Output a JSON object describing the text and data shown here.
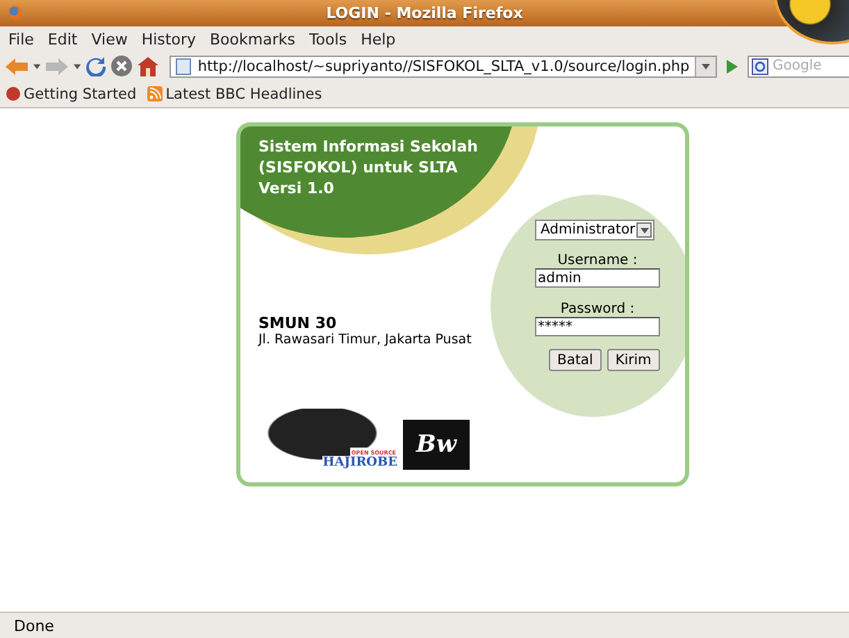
{
  "window": {
    "title": "LOGIN - Mozilla Firefox"
  },
  "menu": [
    "File",
    "Edit",
    "View",
    "History",
    "Bookmarks",
    "Tools",
    "Help"
  ],
  "address": {
    "value": "http://localhost/~supriyanto//SISFOKOL_SLTA_v1.0/source/login.php"
  },
  "search": {
    "placeholder": "Google"
  },
  "bookmarks": [
    "Getting Started",
    "Latest BBC Headlines"
  ],
  "login": {
    "title_lines": [
      "Sistem Informasi Sekolah",
      "(SISFOKOL) untuk SLTA",
      "Versi 1.0"
    ],
    "school": "SMUN 30",
    "address": "Jl. Rawasari Timur, Jakarta Pusat",
    "role": "Administrator",
    "username_label": "Username :",
    "username": "admin",
    "password_label": "Password :",
    "password": "*****",
    "buttons": [
      "Batal",
      "Kirim"
    ],
    "logos": {
      "hajirobe_tag": "OPEN SOURCE",
      "hajirobe": "HAJIROBE",
      "bw": "Bw"
    }
  },
  "status_bar": "Done"
}
